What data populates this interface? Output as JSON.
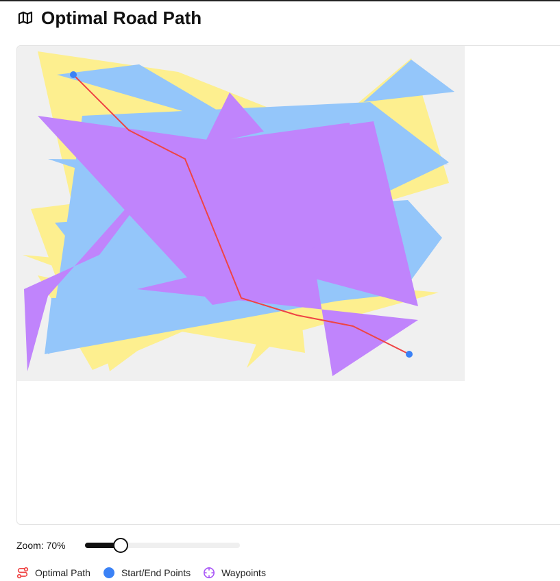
{
  "header": {
    "title": "Optimal Road Path",
    "icon": "map-icon"
  },
  "map": {
    "background_color": "#f0f0f0",
    "colors": {
      "yellow": "#fdef8f",
      "blue": "#94c6fa",
      "purple": "#c084fc",
      "path": "#ef4444",
      "endpoint": "#3b82f6"
    },
    "regions": [
      {
        "color": "yellow",
        "points": [
          [
            30,
            8
          ],
          [
            235,
            38
          ],
          [
            555,
            165
          ],
          [
            135,
            475
          ]
        ]
      },
      {
        "color": "yellow",
        "points": [
          [
            575,
            18
          ],
          [
            630,
            200
          ],
          [
            210,
            325
          ]
        ]
      },
      {
        "color": "yellow",
        "points": [
          [
            20,
            238
          ],
          [
            420,
            188
          ],
          [
            520,
            362
          ],
          [
            95,
            442
          ]
        ]
      },
      {
        "color": "yellow",
        "points": [
          [
            8,
            305
          ],
          [
            615,
            360
          ],
          [
            355,
            432
          ]
        ]
      },
      {
        "color": "yellow",
        "points": [
          [
            30,
            335
          ],
          [
            300,
            392
          ],
          [
            110,
            473
          ]
        ]
      },
      {
        "color": "yellow",
        "points": [
          [
            335,
            470
          ],
          [
            390,
            332
          ],
          [
            485,
            330
          ]
        ]
      },
      {
        "color": "yellow",
        "points": [
          [
            170,
            405
          ],
          [
            415,
            400
          ],
          [
            420,
            448
          ]
        ]
      },
      {
        "color": "yellow",
        "points": [
          [
            375,
            300
          ],
          [
            505,
            283
          ],
          [
            500,
            375
          ]
        ]
      },
      {
        "color": "blue",
        "points": [
          [
            58,
            42
          ],
          [
            178,
            27
          ],
          [
            345,
            125
          ]
        ]
      },
      {
        "color": "blue",
        "points": [
          [
            575,
            20
          ],
          [
            638,
            67
          ],
          [
            505,
            82
          ]
        ]
      },
      {
        "color": "blue",
        "points": [
          [
            95,
            102
          ],
          [
            515,
            82
          ],
          [
            630,
            170
          ],
          [
            45,
            450
          ]
        ]
      },
      {
        "color": "blue",
        "points": [
          [
            45,
            165
          ],
          [
            630,
            172
          ],
          [
            255,
            235
          ]
        ]
      },
      {
        "color": "blue",
        "points": [
          [
            55,
            258
          ],
          [
            570,
            225
          ],
          [
            620,
            280
          ],
          [
            560,
            362
          ],
          [
            170,
            405
          ]
        ]
      },
      {
        "color": "blue",
        "points": [
          [
            415,
            377
          ],
          [
            460,
            330
          ],
          [
            560,
            335
          ]
        ]
      },
      {
        "color": "blue",
        "points": [
          [
            50,
            368
          ],
          [
            535,
            360
          ],
          [
            40,
            450
          ]
        ]
      },
      {
        "color": "purple",
        "points": [
          [
            30,
            102
          ],
          [
            285,
            378
          ],
          [
            415,
            355
          ],
          [
            370,
            150
          ]
        ]
      },
      {
        "color": "purple",
        "points": [
          [
            130,
            165
          ],
          [
            520,
            110
          ],
          [
            585,
            380
          ],
          [
            230,
            285
          ]
        ]
      },
      {
        "color": "purple",
        "points": [
          [
            245,
            145
          ],
          [
            485,
            112
          ],
          [
            490,
            335
          ],
          [
            300,
            315
          ]
        ]
      },
      {
        "color": "purple",
        "points": [
          [
            10,
            355
          ],
          [
            120,
            305
          ],
          [
            245,
            140
          ],
          [
            45,
            365
          ],
          [
            15,
            475
          ]
        ]
      },
      {
        "color": "purple",
        "points": [
          [
            175,
            355
          ],
          [
            530,
            272
          ],
          [
            430,
            295
          ],
          [
            460,
            482
          ],
          [
            585,
            400
          ]
        ]
      },
      {
        "color": "purple",
        "points": [
          [
            272,
            145
          ],
          [
            310,
            68
          ],
          [
            360,
            125
          ]
        ]
      }
    ],
    "path": [
      [
        82,
        42
      ],
      [
        163,
        123
      ],
      [
        245,
        165
      ],
      [
        327,
        368
      ],
      [
        408,
        393
      ],
      [
        490,
        409
      ],
      [
        572,
        450
      ]
    ],
    "start_point": [
      82,
      42
    ],
    "end_point": [
      572,
      450
    ]
  },
  "zoom": {
    "label": "Zoom: 70%",
    "level_fraction": 0.23
  },
  "legend": [
    {
      "icon": "route-icon",
      "label": "Optimal Path",
      "color": "#ef4444"
    },
    {
      "icon": "dot-icon",
      "label": "Start/End Points",
      "color": "#3b82f6"
    },
    {
      "icon": "crosshair-icon",
      "label": "Waypoints",
      "color": "#a855f7"
    }
  ]
}
